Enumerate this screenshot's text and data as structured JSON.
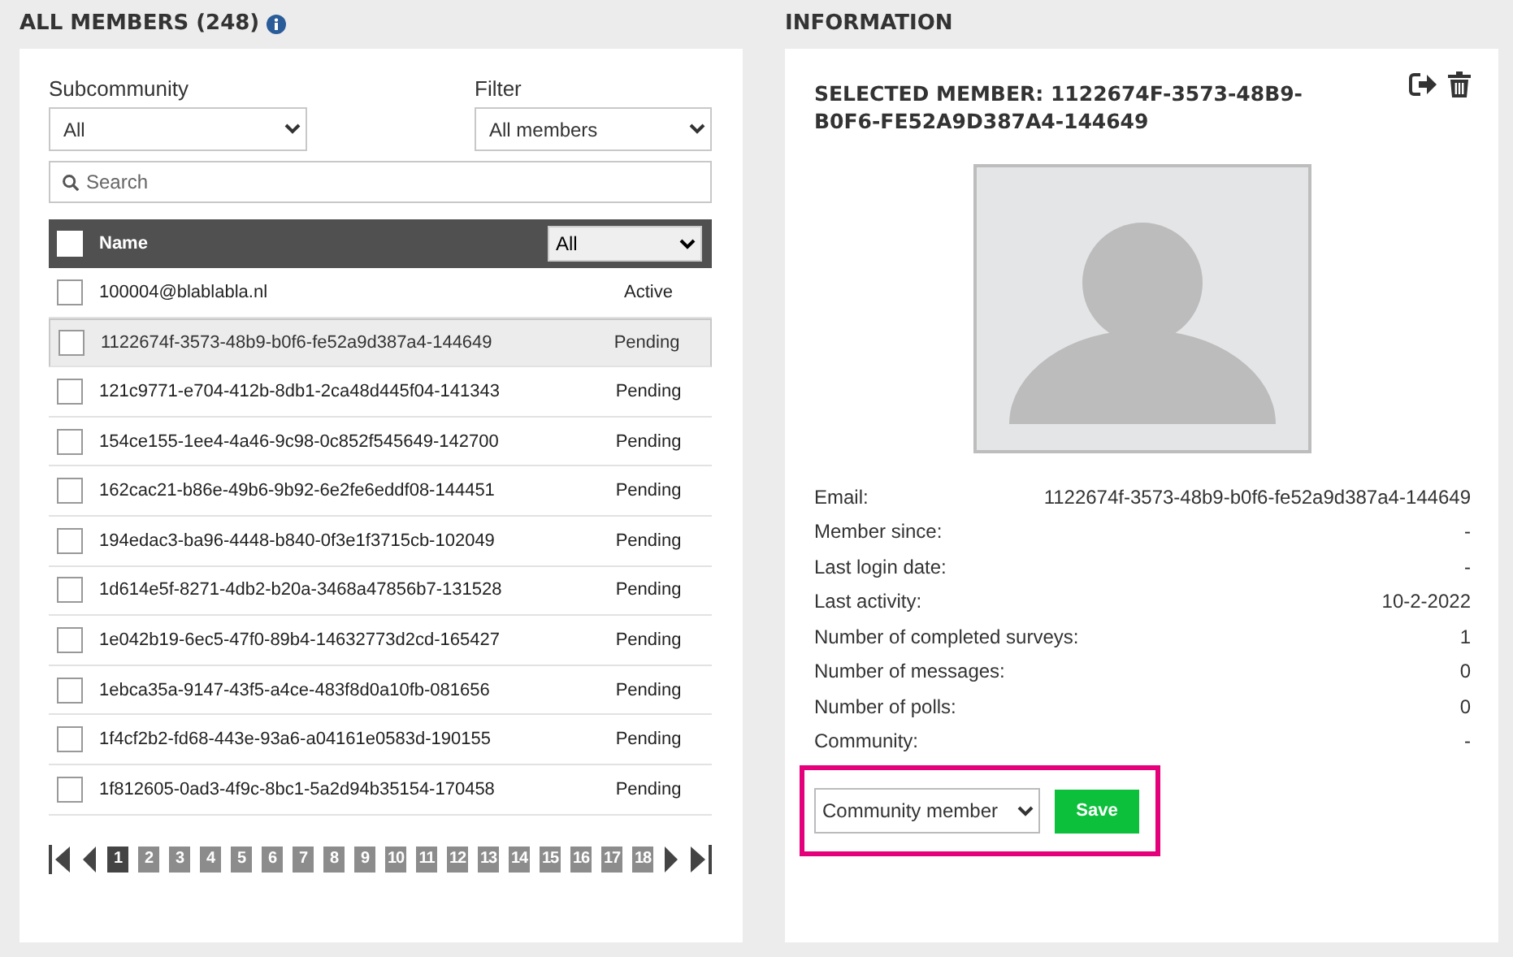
{
  "members_panel": {
    "title": "ALL MEMBERS (248)",
    "subcommunity": {
      "label": "Subcommunity",
      "value": "All"
    },
    "filter": {
      "label": "Filter",
      "value": "All members"
    },
    "search": {
      "placeholder": "Search"
    },
    "table": {
      "header_checked": false,
      "column_name": "Name",
      "status_filter": "All",
      "rows": [
        {
          "name": "100004@blablabla.nl",
          "status": "Active",
          "checked": false,
          "selected": false
        },
        {
          "name": "1122674f-3573-48b9-b0f6-fe52a9d387a4-144649",
          "status": "Pending",
          "checked": false,
          "selected": true
        },
        {
          "name": "121c9771-e704-412b-8db1-2ca48d445f04-141343",
          "status": "Pending",
          "checked": false,
          "selected": false
        },
        {
          "name": "154ce155-1ee4-4a46-9c98-0c852f545649-142700",
          "status": "Pending",
          "checked": false,
          "selected": false
        },
        {
          "name": "162cac21-b86e-49b6-9b92-6e2fe6eddf08-144451",
          "status": "Pending",
          "checked": false,
          "selected": false
        },
        {
          "name": "194edac3-ba96-4448-b840-0f3e1f3715cb-102049",
          "status": "Pending",
          "checked": false,
          "selected": false
        },
        {
          "name": "1d614e5f-8271-4db2-b20a-3468a47856b7-131528",
          "status": "Pending",
          "checked": false,
          "selected": false
        },
        {
          "name": "1e042b19-6ec5-47f0-89b4-14632773d2cd-165427",
          "status": "Pending",
          "checked": false,
          "selected": false
        },
        {
          "name": "1ebca35a-9147-43f5-a4ce-483f8d0a10fb-081656",
          "status": "Pending",
          "checked": false,
          "selected": false
        },
        {
          "name": "1f4cf2b2-fd68-443e-93a6-a04161e0583d-190155",
          "status": "Pending",
          "checked": false,
          "selected": false
        },
        {
          "name": "1f812605-0ad3-4f9c-8bc1-5a2d94b35154-170458",
          "status": "Pending",
          "checked": false,
          "selected": false
        }
      ]
    },
    "pagination": [
      {
        "label": "1",
        "selected": true
      },
      {
        "label": "2",
        "selected": false
      },
      {
        "label": "3",
        "selected": false
      },
      {
        "label": "4",
        "selected": false
      },
      {
        "label": "5",
        "selected": false
      },
      {
        "label": "6",
        "selected": false
      },
      {
        "label": "7",
        "selected": false
      },
      {
        "label": "8",
        "selected": false
      },
      {
        "label": "9",
        "selected": false
      },
      {
        "label": "10",
        "selected": false
      },
      {
        "label": "11",
        "selected": false
      },
      {
        "label": "12",
        "selected": false
      },
      {
        "label": "13",
        "selected": false
      },
      {
        "label": "14",
        "selected": false
      },
      {
        "label": "15",
        "selected": false
      },
      {
        "label": "16",
        "selected": false
      },
      {
        "label": "17",
        "selected": false
      },
      {
        "label": "18",
        "selected": false
      }
    ]
  },
  "information_panel": {
    "title": "INFORMATION",
    "selected_member": "SELECTED MEMBER: 1122674F-3573-48B9-B0F6-FE52A9D387A4-144649",
    "details": [
      {
        "label": "Email:",
        "value": "1122674f-3573-48b9-b0f6-fe52a9d387a4-144649"
      },
      {
        "label": "Member since:",
        "value": "-"
      },
      {
        "label": "Last login date:",
        "value": "-"
      },
      {
        "label": "Last activity:",
        "value": "10-2-2022"
      },
      {
        "label": "Number of completed surveys:",
        "value": "1"
      },
      {
        "label": "Number of messages:",
        "value": "0"
      },
      {
        "label": "Number of polls:",
        "value": "0"
      },
      {
        "label": "Community:",
        "value": "-"
      }
    ],
    "role": "Community member",
    "save_button": "Save"
  }
}
